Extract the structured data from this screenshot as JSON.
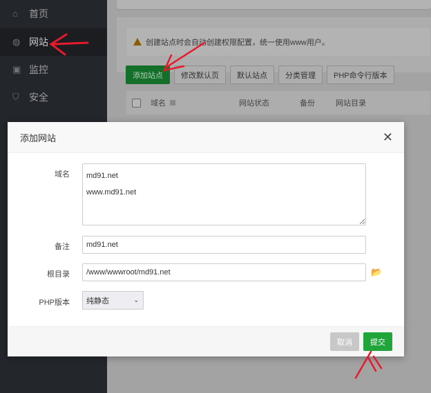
{
  "sidebar": {
    "items": [
      {
        "label": "首页",
        "icon": "home-icon"
      },
      {
        "label": "网站",
        "icon": "globe-icon",
        "active": true
      },
      {
        "label": "监控",
        "icon": "monitor-icon"
      },
      {
        "label": "安全",
        "icon": "shield-icon"
      }
    ]
  },
  "main": {
    "alert": "创建站点时会自动创建权限配置，统一使用www用户。",
    "toolbar": [
      "添加站点",
      "修改默认页",
      "默认站点",
      "分类管理",
      "PHP命令行版本"
    ],
    "table_headers": [
      "域名",
      "网站状态",
      "备份",
      "网站目录"
    ]
  },
  "modal": {
    "title": "添加网站",
    "domain_label": "域名",
    "domain_value": "md91.net\nwww.md91.net",
    "note_label": "备注",
    "note_value": "md91.net",
    "root_label": "根目录",
    "root_value": "/www/wwwroot/md91.net",
    "php_label": "PHP版本",
    "php_value": "纯静态",
    "cancel": "取消",
    "submit": "提交"
  },
  "colors": {
    "accent": "#20a53a",
    "annotation": "#e8192c"
  }
}
